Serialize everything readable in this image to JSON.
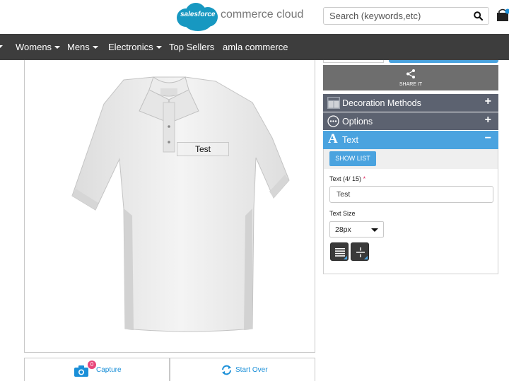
{
  "header": {
    "logo_word": "salesforce",
    "logo_text": "commerce cloud",
    "search_placeholder": "Search (keywords,etc)"
  },
  "nav": {
    "items": [
      {
        "label": "Womens",
        "dropdown": true
      },
      {
        "label": "Mens",
        "dropdown": true
      },
      {
        "label": "Electronics",
        "dropdown": true
      },
      {
        "label": "Top Sellers",
        "dropdown": false
      },
      {
        "label": "amla commerce",
        "dropdown": false
      }
    ]
  },
  "designer": {
    "preview_text": "Test",
    "capture_label": "Capture",
    "capture_count": "0",
    "start_over_label": "Start Over"
  },
  "panel": {
    "share_label": "SHARE IT",
    "decoration_methods": "Decoration Methods",
    "options": "Options",
    "text_section": "Text",
    "show_list": "SHOW LIST",
    "text_field_label": "Text",
    "text_counter": "(4/ 15)",
    "required_mark": "*",
    "text_value": "Test",
    "text_size_label": "Text Size",
    "text_size_value": "28px"
  },
  "colors": {
    "accent": "#4aa3df",
    "nav_bg": "#3d3d3d",
    "accordion_bg": "#5c6270",
    "share_bg": "#6e6e6e",
    "badge": "#e8477b"
  }
}
